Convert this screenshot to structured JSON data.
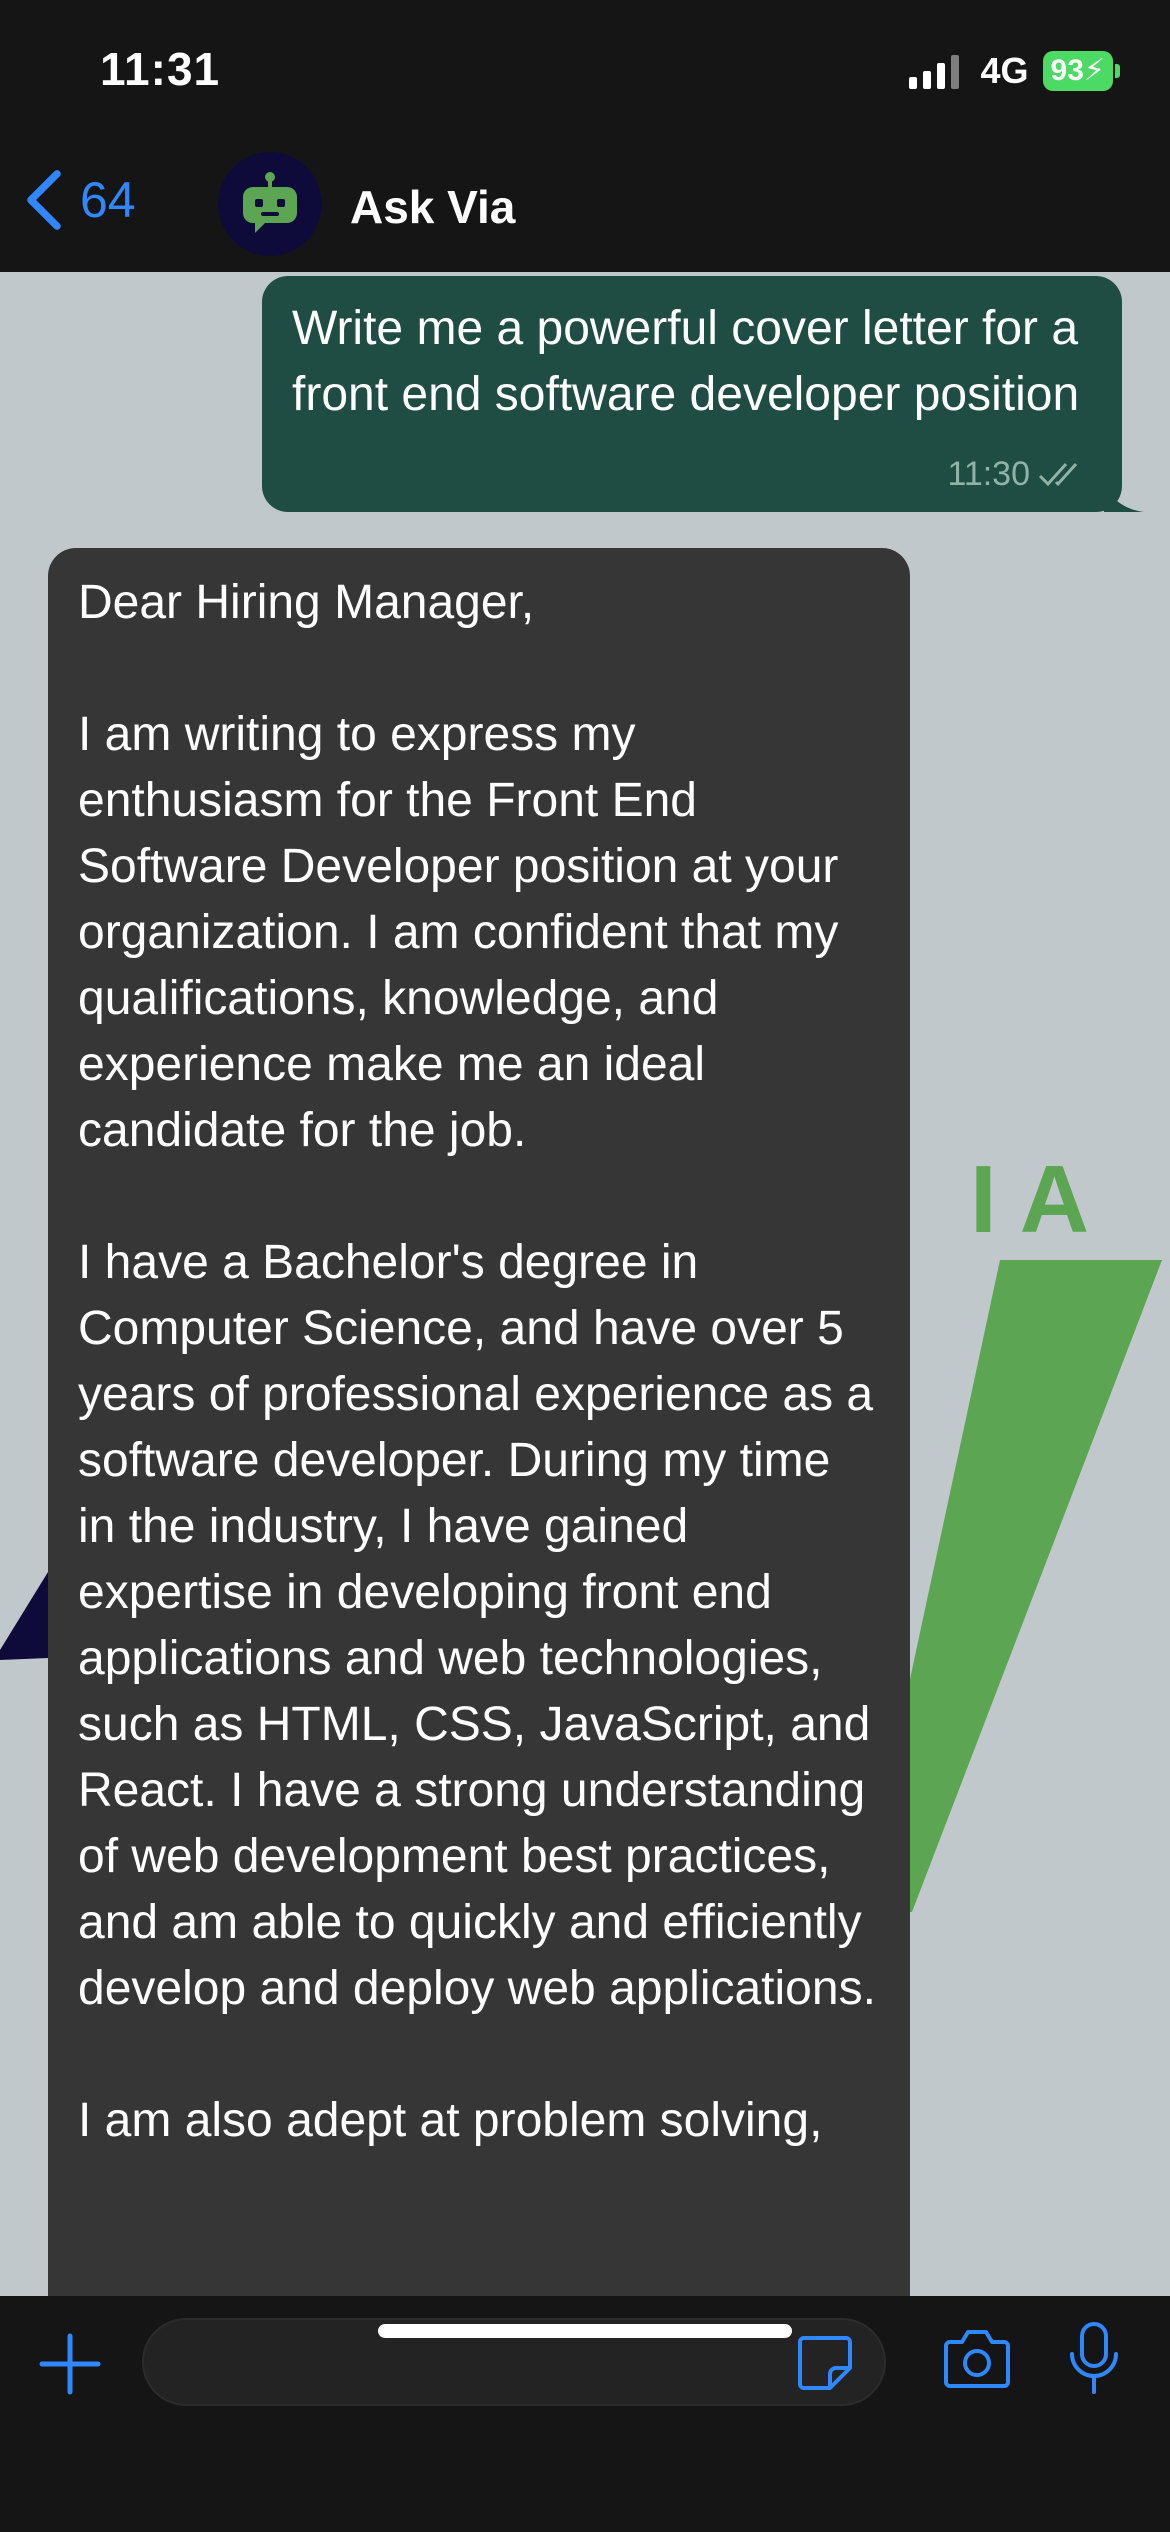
{
  "status_bar": {
    "time": "11:31",
    "network": "4G",
    "battery": "93"
  },
  "header": {
    "back_count": "64",
    "chat_name": "Ask Via"
  },
  "messages": {
    "outgoing": {
      "text": "Write me a powerful cover letter for a front end software developer position",
      "time": "11:30"
    },
    "incoming": {
      "paragraphs": [
        "Dear Hiring Manager,",
        "I am writing to express my enthusiasm for the Front End Software Developer position at your organization. I am confident that my qualifications, knowledge, and experience make me an ideal candidate for the job.",
        "I have a Bachelor's degree in Computer Science, and have over 5 years of professional experience as a software developer. During my time in the industry, I have gained expertise in developing front end applications and web technologies, such as HTML, CSS, JavaScript, and React. I have a strong understanding of web development best practices, and am able to quickly and efficiently develop and deploy web applications.",
        "I am also adept at problem solving,"
      ]
    }
  },
  "watermark": {
    "letters": "I A"
  },
  "colors": {
    "accent": "#2f88ff",
    "outgoing_bubble": "#1f4d43",
    "incoming_bubble": "#363636",
    "chat_background": "#c1c8cb",
    "logo_green": "#5ba553"
  }
}
